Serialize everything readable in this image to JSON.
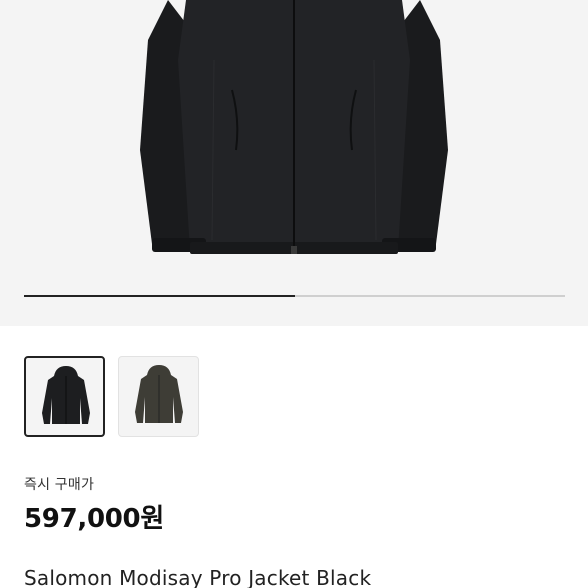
{
  "gallery": {
    "images": [
      {
        "name": "jacket-black-front",
        "color": "#1d1e20"
      },
      {
        "name": "jacket-olive-front",
        "color": "#3e3d36"
      }
    ],
    "selected_index": 0,
    "progress": 0.5
  },
  "purchase": {
    "label": "즉시 구매가",
    "price": "597,000원"
  },
  "product": {
    "name": "Salomon Modisay Pro Jacket Black"
  }
}
